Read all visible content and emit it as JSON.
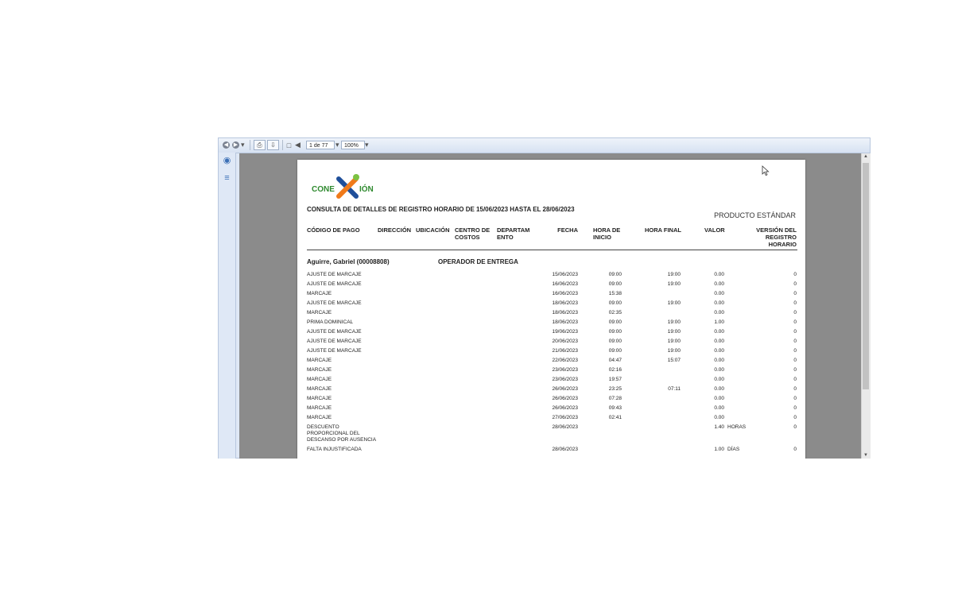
{
  "toolbar": {
    "page_indicator": "1 de 77",
    "zoom": "100%",
    "icons": [
      "back-icon",
      "forward-icon",
      "print-icon",
      "export-icon",
      "first-page-icon",
      "prev-page-icon"
    ]
  },
  "sidebar": {
    "icons": [
      "binoculars-icon",
      "tree-icon"
    ]
  },
  "report": {
    "logo_text": "CONE ÓN",
    "title": "CONSULTA DE DETALLES DE REGISTRO HORARIO DE 15/06/2023 HASTA EL 28/06/2023",
    "product": "PRODUCTO ESTÁNDAR",
    "headers": {
      "codigo": "CÓDIGO DE PAGO",
      "direccion": "DIRECCIÓN",
      "ubicacion": "UBICACIÓN",
      "centro": "CENTRO DE\nCOSTOS",
      "departamento": "DEPARTAM\nENTO",
      "fecha": "FECHA",
      "hora_inicio": "HORA DE\nINICIO",
      "hora_final": "HORA FINAL",
      "valor": "VALOR",
      "version": "VERSIÓN DEL\nREGISTRO\nHORARIO"
    },
    "employee": {
      "name": "Aguirre, Gabriel (00008808)",
      "role": "OPERADOR DE ENTREGA"
    },
    "rows": [
      {
        "code": "AJUSTE DE MARCAJE",
        "date": "15/06/2023",
        "start": "09:00",
        "end": "19:00",
        "value": "0.00",
        "unit": "",
        "version": "0"
      },
      {
        "code": "AJUSTE DE MARCAJE",
        "date": "16/06/2023",
        "start": "09:00",
        "end": "19:00",
        "value": "0.00",
        "unit": "",
        "version": "0"
      },
      {
        "code": "MARCAJE",
        "date": "16/06/2023",
        "start": "15:38",
        "end": "",
        "value": "0.00",
        "unit": "",
        "version": "0"
      },
      {
        "code": "AJUSTE DE MARCAJE",
        "date": "18/06/2023",
        "start": "09:00",
        "end": "19:00",
        "value": "0.00",
        "unit": "",
        "version": "0"
      },
      {
        "code": "MARCAJE",
        "date": "18/06/2023",
        "start": "02:35",
        "end": "",
        "value": "0.00",
        "unit": "",
        "version": "0"
      },
      {
        "code": "PRIMA DOMINICAL",
        "date": "18/06/2023",
        "start": "09:00",
        "end": "19:00",
        "value": "1.00",
        "unit": "",
        "version": "0"
      },
      {
        "code": "AJUSTE DE MARCAJE",
        "date": "19/06/2023",
        "start": "09:00",
        "end": "19:00",
        "value": "0.00",
        "unit": "",
        "version": "0"
      },
      {
        "code": "AJUSTE DE MARCAJE",
        "date": "20/06/2023",
        "start": "09:00",
        "end": "19:00",
        "value": "0.00",
        "unit": "",
        "version": "0"
      },
      {
        "code": "AJUSTE DE MARCAJE",
        "date": "21/06/2023",
        "start": "09:00",
        "end": "19:00",
        "value": "0.00",
        "unit": "",
        "version": "0"
      },
      {
        "code": "MARCAJE",
        "date": "22/06/2023",
        "start": "04:47",
        "end": "15:07",
        "value": "0.00",
        "unit": "",
        "version": "0"
      },
      {
        "code": "MARCAJE",
        "date": "23/06/2023",
        "start": "02:16",
        "end": "",
        "value": "0.00",
        "unit": "",
        "version": "0"
      },
      {
        "code": "MARCAJE",
        "date": "23/06/2023",
        "start": "19:57",
        "end": "",
        "value": "0.00",
        "unit": "",
        "version": "0"
      },
      {
        "code": "MARCAJE",
        "date": "26/06/2023",
        "start": "23:25",
        "end": "07:11",
        "value": "0.00",
        "unit": "",
        "version": "0"
      },
      {
        "code": "MARCAJE",
        "date": "26/06/2023",
        "start": "07:28",
        "end": "",
        "value": "0.00",
        "unit": "",
        "version": "0"
      },
      {
        "code": "MARCAJE",
        "date": "26/06/2023",
        "start": "09:43",
        "end": "",
        "value": "0.00",
        "unit": "",
        "version": "0"
      },
      {
        "code": "MARCAJE",
        "date": "27/06/2023",
        "start": "02:41",
        "end": "",
        "value": "0.00",
        "unit": "",
        "version": "0"
      },
      {
        "code": "DESCUENTO\nPROPORCIONAL DEL\nDESCANSO POR AUSENCIA",
        "date": "28/06/2023",
        "start": "",
        "end": "",
        "value": "1.40",
        "unit": "HORAS",
        "version": "0"
      },
      {
        "code": "FALTA INJUSTIFICADA",
        "date": "28/06/2023",
        "start": "",
        "end": "",
        "value": "1.00",
        "unit": "DÍAS",
        "version": "0"
      }
    ]
  }
}
